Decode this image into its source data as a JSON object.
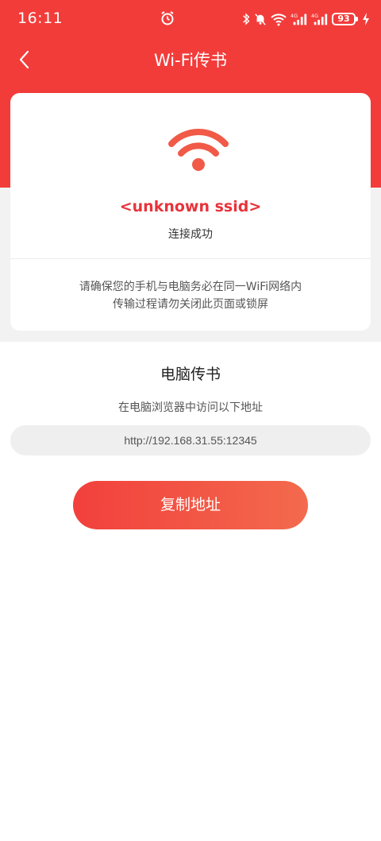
{
  "status_bar": {
    "time": "16:11",
    "battery": "93"
  },
  "nav": {
    "title": "Wi-Fi传书"
  },
  "card": {
    "ssid": "<unknown ssid>",
    "status": "连接成功",
    "notice_line1": "请确保您的手机与电脑务必在同一WiFi网络内",
    "notice_line2": "传输过程请勿关闭此页面或锁屏"
  },
  "transfer": {
    "title": "电脑传书",
    "subtitle": "在电脑浏览器中访问以下地址",
    "url": "http://192.168.31.55:12345",
    "copy_button": "复制地址"
  },
  "colors": {
    "brand": "#f23c3a",
    "accent_text": "#e8333a",
    "wifi_icon": "#f05a47"
  },
  "icons": {
    "back": "chevron-left-icon",
    "wifi": "wifi-icon",
    "alarm": "alarm-icon"
  }
}
